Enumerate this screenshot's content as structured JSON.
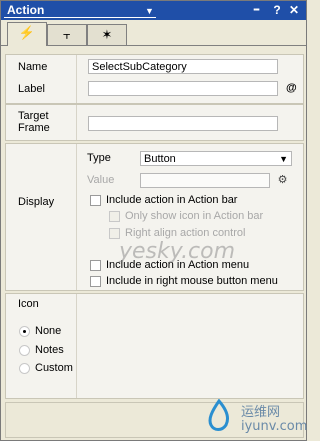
{
  "panel": {
    "title": "Action",
    "toolbar_buttons": [
      "▪▪▪",
      "?",
      "✕"
    ]
  },
  "tabs": [
    {
      "icon": "lightning-icon",
      "glyph": "⚡",
      "active": true
    },
    {
      "icon": "link-icon",
      "glyph": "⫟",
      "active": false
    },
    {
      "icon": "settings-icon",
      "glyph": "✶",
      "active": false
    }
  ],
  "name_section": {
    "name_label": "Name",
    "name_value": "SelectSubCategory",
    "label_label": "Label",
    "label_value": "",
    "at_symbol": "@"
  },
  "target_section": {
    "label_line1": "Target",
    "label_line2": "Frame",
    "value": ""
  },
  "display_section": {
    "label": "Display",
    "type_label": "Type",
    "type_value": "Button",
    "value_label": "Value",
    "value_value": "",
    "checkboxes": [
      {
        "label": "Include action in Action bar",
        "enabled": true,
        "checked": false
      },
      {
        "label": "Only show icon in Action bar",
        "enabled": false,
        "checked": false
      },
      {
        "label": "Right align action control",
        "enabled": false,
        "checked": false
      },
      {
        "label": "Include action in Action menu",
        "enabled": true,
        "checked": false
      },
      {
        "label": "Include in right mouse button menu",
        "enabled": true,
        "checked": false
      }
    ]
  },
  "icon_section": {
    "label": "Icon",
    "options": [
      {
        "label": "None",
        "selected": true
      },
      {
        "label": "Notes",
        "selected": false
      },
      {
        "label": "Custom",
        "selected": false
      }
    ]
  },
  "watermark": {
    "site1": "yesky.com",
    "site2": "iyunv.com",
    "site2_cn": "运维网"
  },
  "colors": {
    "title_bar": "#1f4fa8",
    "panel_bg": "#ece9d8"
  }
}
